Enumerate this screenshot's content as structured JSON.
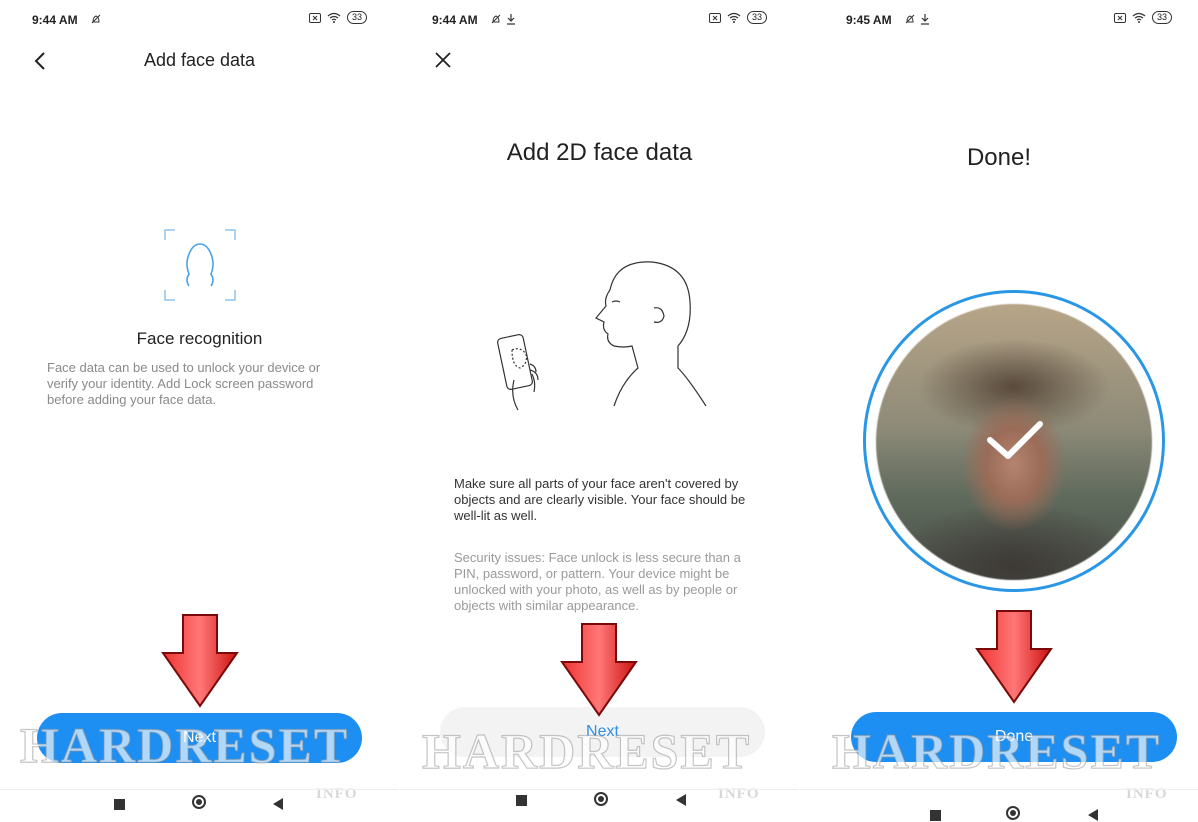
{
  "watermark": {
    "text": "HARDRESET",
    "sub": "INFO"
  },
  "accent_color": "#1e8ff2",
  "screen1": {
    "status": {
      "time": "9:44 AM",
      "battery": "33"
    },
    "title": "Add face data",
    "back_icon": "chevron-left-icon",
    "heading": "Face recognition",
    "description": "Face data can be used to unlock your device or verify your identity. Add Lock screen password before adding your face data.",
    "next_label": "Next"
  },
  "screen2": {
    "status": {
      "time": "9:44 AM",
      "battery": "33"
    },
    "close_icon": "close-icon",
    "title": "Add 2D face data",
    "paragraph1": "Make sure all parts of your face aren't covered by objects and are clearly visible. Your face should be well-lit as well.",
    "paragraph2": "Security issues: Face unlock is less secure than a PIN, password, or pattern. Your device might be unlocked with your photo, as well as by people or objects with similar appearance.",
    "next_label": "Next"
  },
  "screen3": {
    "status": {
      "time": "9:45 AM",
      "battery": "33"
    },
    "title": "Done!",
    "done_label": "Done"
  }
}
